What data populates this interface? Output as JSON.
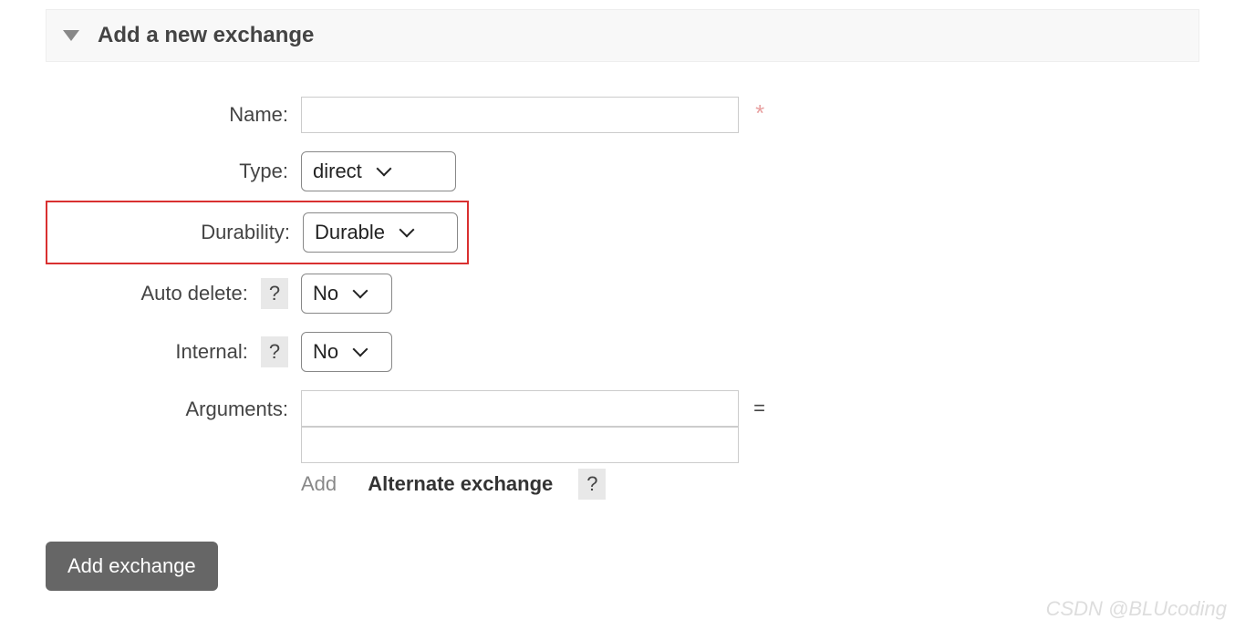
{
  "section": {
    "title": "Add a new exchange"
  },
  "form": {
    "name": {
      "label": "Name:",
      "value": "",
      "required_mark": "*"
    },
    "type": {
      "label": "Type:",
      "value": "direct"
    },
    "durability": {
      "label": "Durability:",
      "value": "Durable"
    },
    "auto_delete": {
      "label": "Auto delete:",
      "help": "?",
      "value": "No"
    },
    "internal": {
      "label": "Internal:",
      "help": "?",
      "value": "No"
    },
    "arguments": {
      "label": "Arguments:",
      "key": "",
      "equals": "=",
      "val": "",
      "add_label": "Add",
      "alt_exchange_label": "Alternate exchange",
      "alt_help": "?"
    }
  },
  "submit": {
    "label": "Add exchange"
  },
  "watermark": "CSDN @BLUcoding"
}
